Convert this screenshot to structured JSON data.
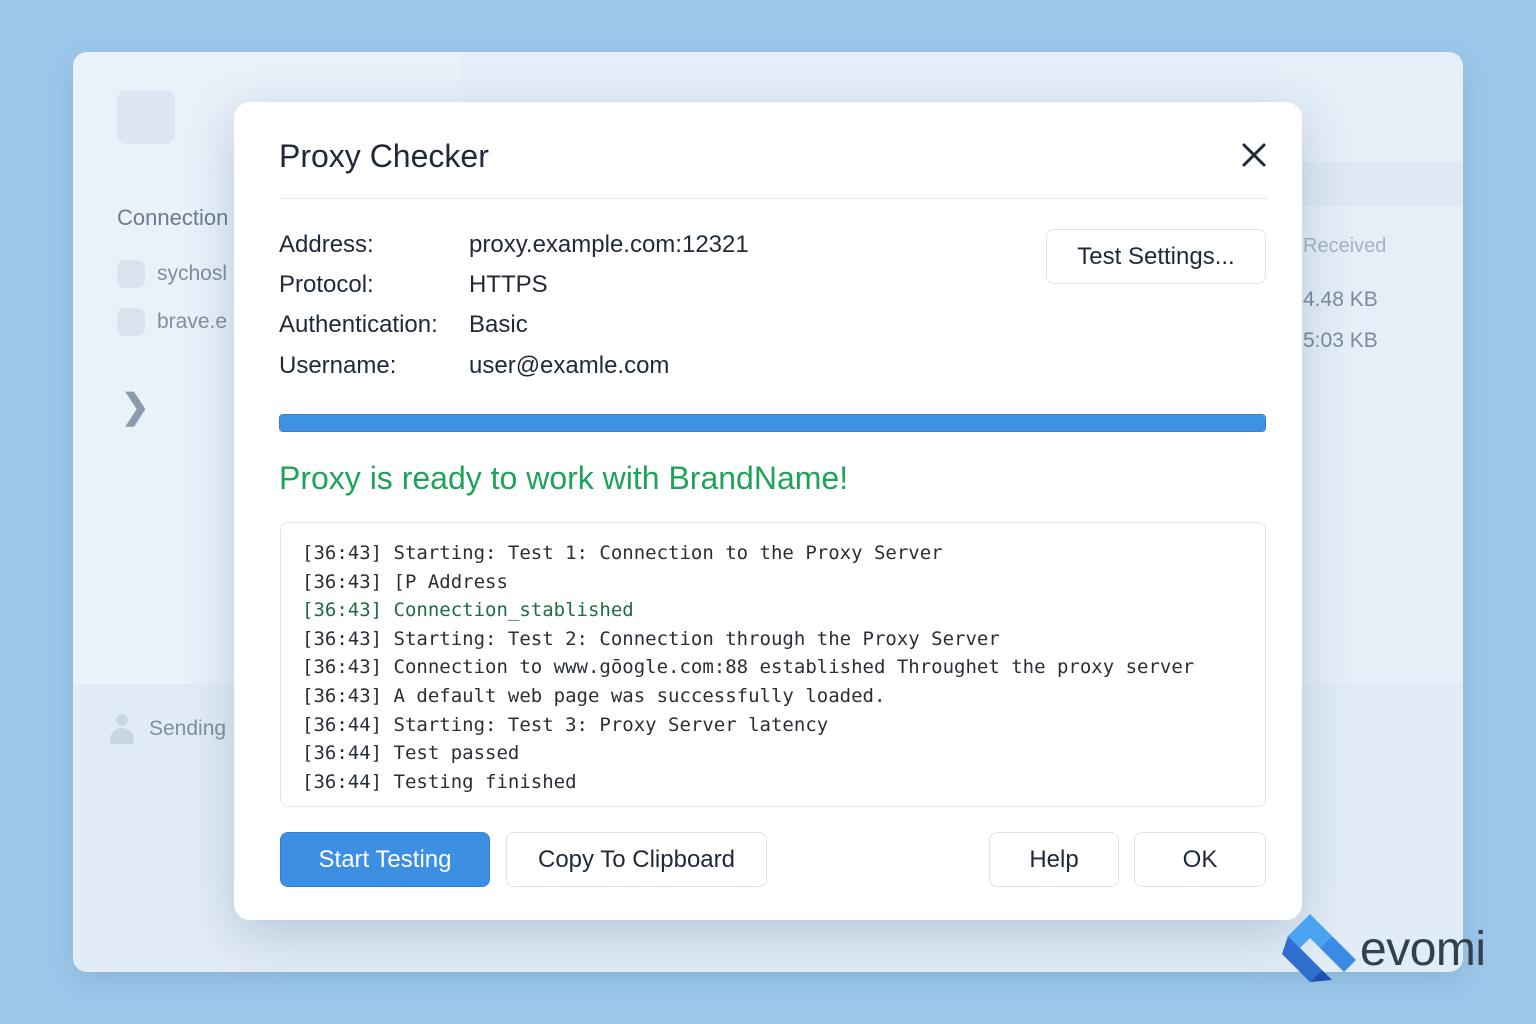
{
  "background_app": {
    "section_title": "Connection",
    "items": [
      {
        "label": "sychosl"
      },
      {
        "label": "brave.e"
      }
    ],
    "footer_status": "Sending",
    "column_header": "Received",
    "values": [
      "4.48 KB",
      "5:03 KB"
    ]
  },
  "dialog": {
    "title": "Proxy Checker",
    "info": [
      {
        "label": "Address:",
        "value": "proxy.example.com:12321"
      },
      {
        "label": "Protocol:",
        "value": "HTTPS"
      },
      {
        "label": "Authentication:",
        "value": "Basic"
      },
      {
        "label": "Username:",
        "value": "user@examle.com"
      }
    ],
    "test_settings_label": "Test Settings...",
    "progress": 1.0,
    "status_message": "Proxy is ready to work with BrandName!",
    "log": [
      "[36:43] Starting: Test 1: Connection to the Proxy Server",
      "[36:43] [P Address",
      "[36:43] Connection_stablished",
      "[36:43] Starting: Test 2: Connection through the Proxy Server",
      "[36:43] Connection to www.gōogle.com:88 established Throughet the proxy server",
      "[36:43] A default web page was successfully loaded.",
      "[36:44] Starting: Test 3: Proxy Server latency",
      "[36:44] Test passed",
      "[36:44] Testing finished"
    ],
    "buttons": {
      "start": "Start Testing",
      "copy": "Copy To Clipboard",
      "help": "Help",
      "ok": "OK"
    }
  },
  "colors": {
    "accent": "#3d8fe4",
    "success": "#1fa35a",
    "background": "#9ec8ea"
  },
  "logo": {
    "text": "evomi"
  }
}
